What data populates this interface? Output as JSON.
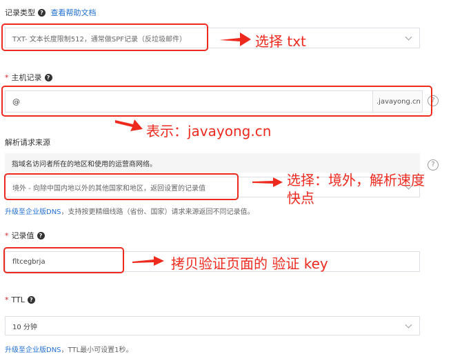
{
  "record_type": {
    "label": "记录类型",
    "help_link": "查看帮助文档",
    "value": "TXT- 文本长度限制512，通常做SPF记录（反垃圾邮件）"
  },
  "host_record": {
    "required_mark": "*",
    "label": "主机记录",
    "value": "@",
    "suffix": ".javayong.cn"
  },
  "request_source": {
    "label": "解析请求来源",
    "tooltip": "指域名访问者所在的地区和使用的运营商网络。",
    "value": "境外 - 向除中国内地以外的其他国家和地区，返回设置的记录值",
    "upgrade_link": "升级至企业版DNS",
    "upgrade_text": "，支持按更精细线路（省份、国家）请求来源返回不同记录值。"
  },
  "record_value": {
    "required_mark": "*",
    "label": "记录值",
    "value": "fltcegbrja"
  },
  "ttl": {
    "required_mark": "*",
    "label": "TTL",
    "value": "10 分钟",
    "upgrade_link": "升级至企业版DNS",
    "upgrade_text": "，TTL最小可设置1秒。"
  },
  "annotations": {
    "txt": "选择 txt",
    "host": "表示：javayong.cn",
    "region_line1": "选择：境外，解析速度",
    "region_line2": "快点",
    "value": "拷贝验证页面的 验证 key"
  },
  "colors": {
    "annotation_red": "#ee2a1f",
    "link_blue": "#1f6fd1",
    "border_gray": "#dcdfe6"
  }
}
